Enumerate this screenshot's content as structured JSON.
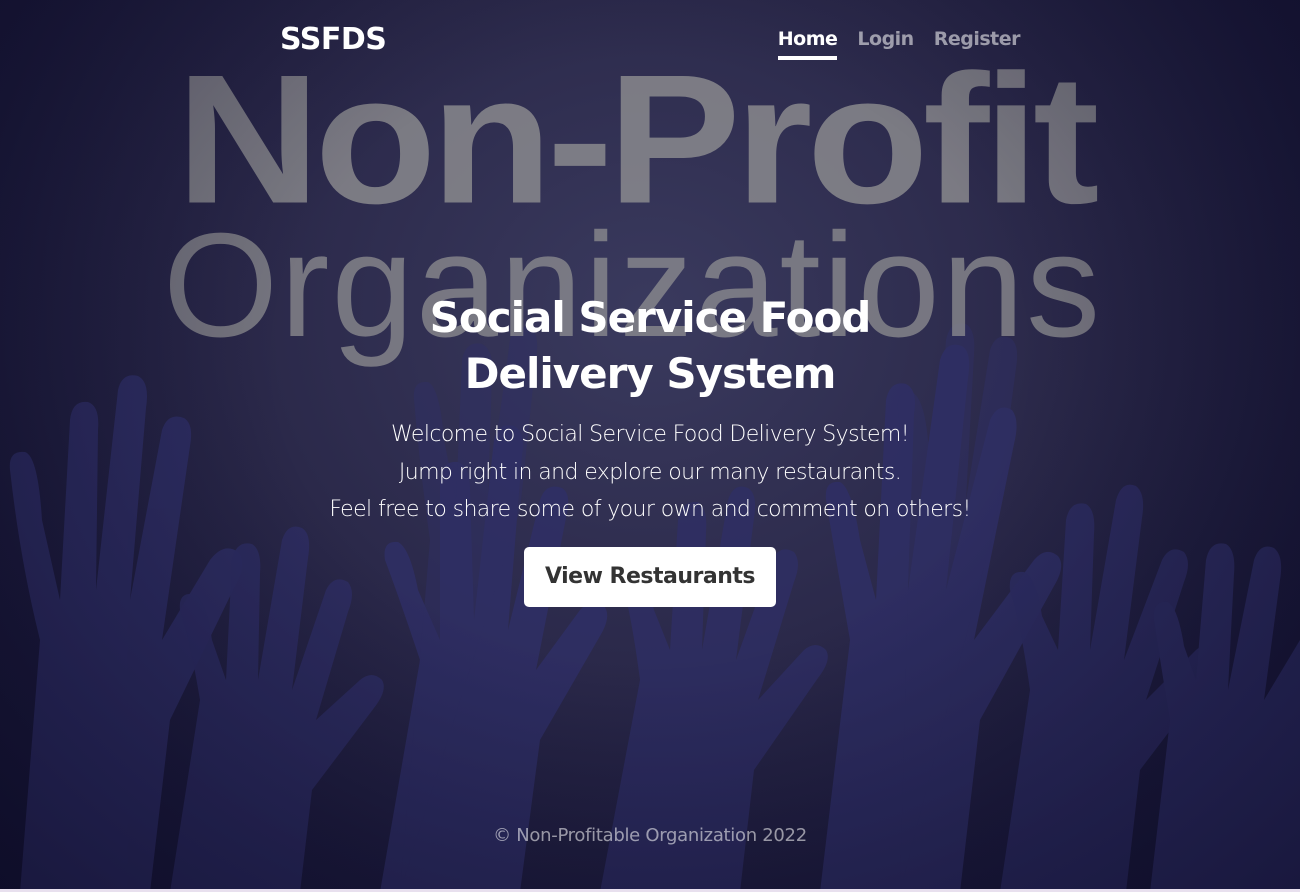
{
  "brand": "SSFDS",
  "nav": {
    "items": [
      {
        "label": "Home",
        "active": true
      },
      {
        "label": "Login",
        "active": false
      },
      {
        "label": "Register",
        "active": false
      }
    ]
  },
  "background": {
    "line1": "Non-Profit",
    "line2": "Organizations",
    "theme": "raised-hands-silhouettes",
    "colors": {
      "base": "#2a2849",
      "hands": "#33336f",
      "text_overlay": "#969696"
    }
  },
  "hero": {
    "title": "Social Service Food Delivery System",
    "lead": [
      "Welcome to Social Service Food Delivery System!",
      "Jump right in and explore our many restaurants.",
      "Feel free to share some of your own and comment on others!"
    ],
    "cta_label": "View Restaurants"
  },
  "footer": {
    "text": "© Non-Profitable Organization 2022"
  }
}
